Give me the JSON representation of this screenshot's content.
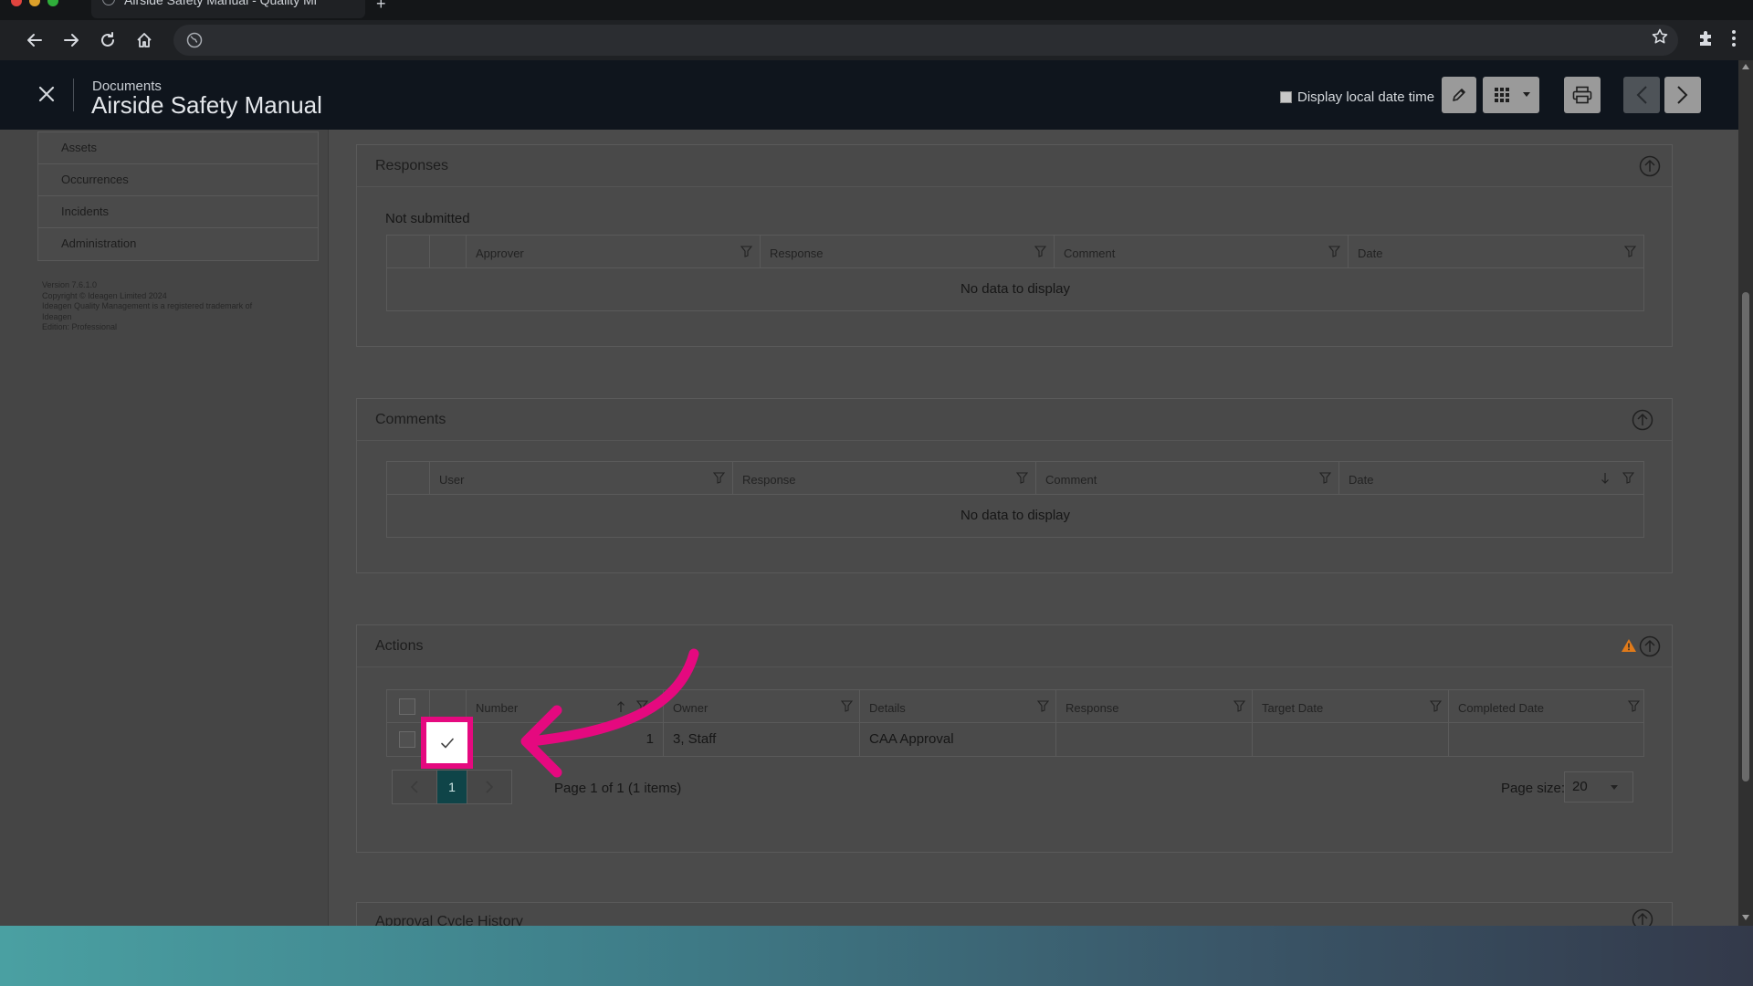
{
  "browser": {
    "tab_title": "Airside Safety Manual - Quality Mi",
    "new_tab_glyph": "+"
  },
  "header": {
    "breadcrumb": "Documents",
    "title": "Airside Safety Manual",
    "display_local_time_label": "Display local date time"
  },
  "sidebar": {
    "items": [
      "Assets",
      "Occurrences",
      "Incidents",
      "Administration"
    ],
    "version_lines": [
      "Version 7.6.1.0",
      "Copyright © Ideagen Limited 2024",
      "Ideagen Quality Management is a registered trademark of",
      "Ideagen",
      "Edition: Professional"
    ]
  },
  "responses": {
    "title": "Responses",
    "status": "Not submitted",
    "columns": [
      "Approver",
      "Response",
      "Comment",
      "Date"
    ],
    "empty_text": "No data to display"
  },
  "comments": {
    "title": "Comments",
    "columns": [
      "User",
      "Response",
      "Comment",
      "Date"
    ],
    "empty_text": "No data to display"
  },
  "actions": {
    "title": "Actions",
    "columns": [
      "Number",
      "Owner",
      "Details",
      "Response",
      "Target Date",
      "Completed Date"
    ],
    "rows": [
      {
        "number": "1",
        "owner": "3, Staff",
        "details": "CAA Approval",
        "response": "",
        "target_date": "",
        "completed_date": ""
      }
    ],
    "pager": {
      "current_page": "1",
      "info": "Page 1 of 1 (1 items)",
      "page_size_label": "Page size:",
      "page_size": "20"
    }
  },
  "approval_history": {
    "title": "Approval Cycle History"
  },
  "colors": {
    "highlight": "#e5097f",
    "warning": "#e07a1a",
    "active_page": "#0f4448"
  }
}
